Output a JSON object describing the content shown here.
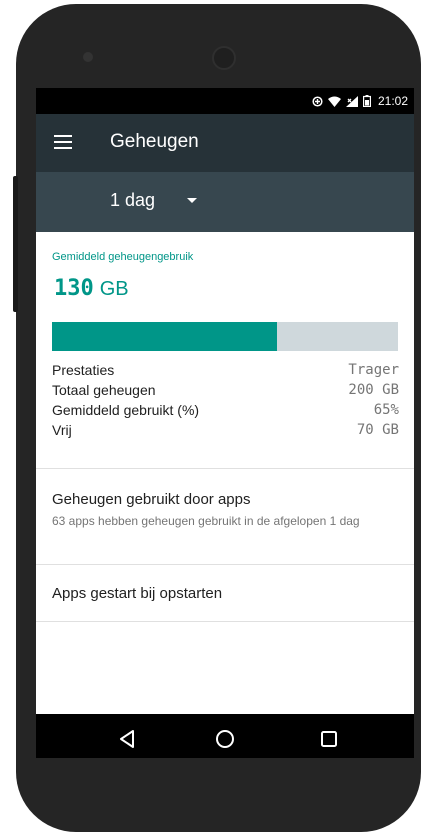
{
  "status_bar": {
    "time": "21:02",
    "icons": [
      "data-saver-icon",
      "wifi-icon",
      "signal-icon",
      "battery-icon"
    ]
  },
  "app_bar": {
    "title": "Geheugen",
    "menu_icon": "menu-icon"
  },
  "period": {
    "selected": "1 dag"
  },
  "memory": {
    "average_label": "Gemiddeld geheugengebruik",
    "average_value": "130",
    "average_unit": "GB",
    "usage_fraction": 0.65,
    "stats": [
      {
        "label": "Prestaties",
        "value": "Trager"
      },
      {
        "label": "Totaal geheugen",
        "value": "200 GB"
      },
      {
        "label": "Gemiddeld gebruikt (%)",
        "value": "65%"
      },
      {
        "label": "Vrij",
        "value": "70 GB"
      }
    ]
  },
  "apps_memory": {
    "title": "Geheugen gebruikt door apps",
    "subtitle": "63 apps hebben geheugen gebruikt in de afgelopen 1 dag"
  },
  "startup_apps": {
    "title": "Apps gestart bij opstarten"
  },
  "nav_bar": {
    "buttons": [
      "back-icon",
      "home-icon",
      "recents-icon"
    ]
  },
  "colors": {
    "accent": "#009688",
    "app_bar": "#263238",
    "selector_bar": "#37474f",
    "bar_track": "#cfd8dc"
  }
}
